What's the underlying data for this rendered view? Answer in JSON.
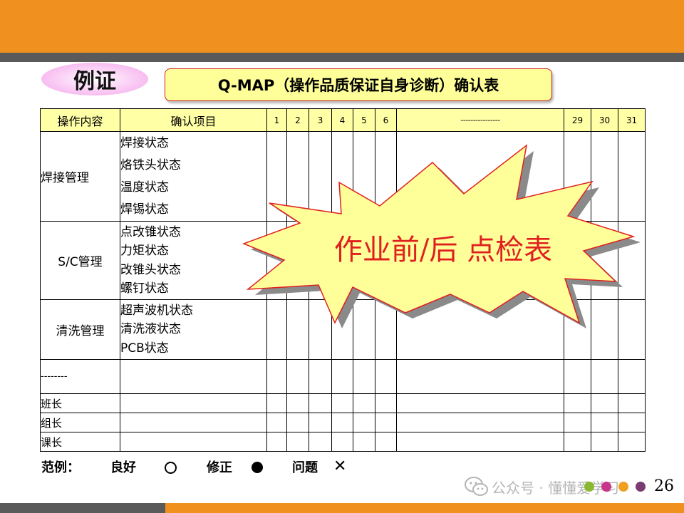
{
  "badge": {
    "label": "例证"
  },
  "title": "Q-MAP（操作品质保证自身诊断）确认表",
  "table": {
    "headers": {
      "operation": "操作内容",
      "items": "确认项目",
      "days_left": [
        "1",
        "2",
        "3",
        "4",
        "5",
        "6"
      ],
      "dash": "----------------",
      "days_right": [
        "29",
        "30",
        "31"
      ]
    },
    "groups": [
      {
        "operation": "焊接管理",
        "items": [
          "焊接状态",
          "烙铁头状态",
          "温度状态",
          "焊锡状态"
        ]
      },
      {
        "operation": "S/C管理",
        "items": [
          "点改锥状态",
          "力矩状态",
          "改锥头状态",
          "螺钉状态"
        ]
      },
      {
        "operation": "清洗管理",
        "items": [
          "超声波机状态",
          "清洗液状态",
          "PCB状态"
        ]
      }
    ],
    "dash_row": "--------",
    "roles": [
      "班长",
      "组长",
      "课长"
    ]
  },
  "burst": {
    "text": "作业前/后 点检表"
  },
  "legend": {
    "label": "范例：",
    "good": "良好",
    "fix": "修正",
    "problem": "问题"
  },
  "watermark": {
    "text": "公众号 · 懂懂爱学习"
  },
  "page_number": "26",
  "colors": {
    "orange": "#f0901e",
    "dark_gray": "#5a5a5a",
    "header_yellow": "#ffffa6",
    "burst_yellow": "#ffff99",
    "burst_red": "#e02020",
    "dots": [
      "#8ab832",
      "#c8348a",
      "#f0a020",
      "#7a3a72"
    ]
  }
}
